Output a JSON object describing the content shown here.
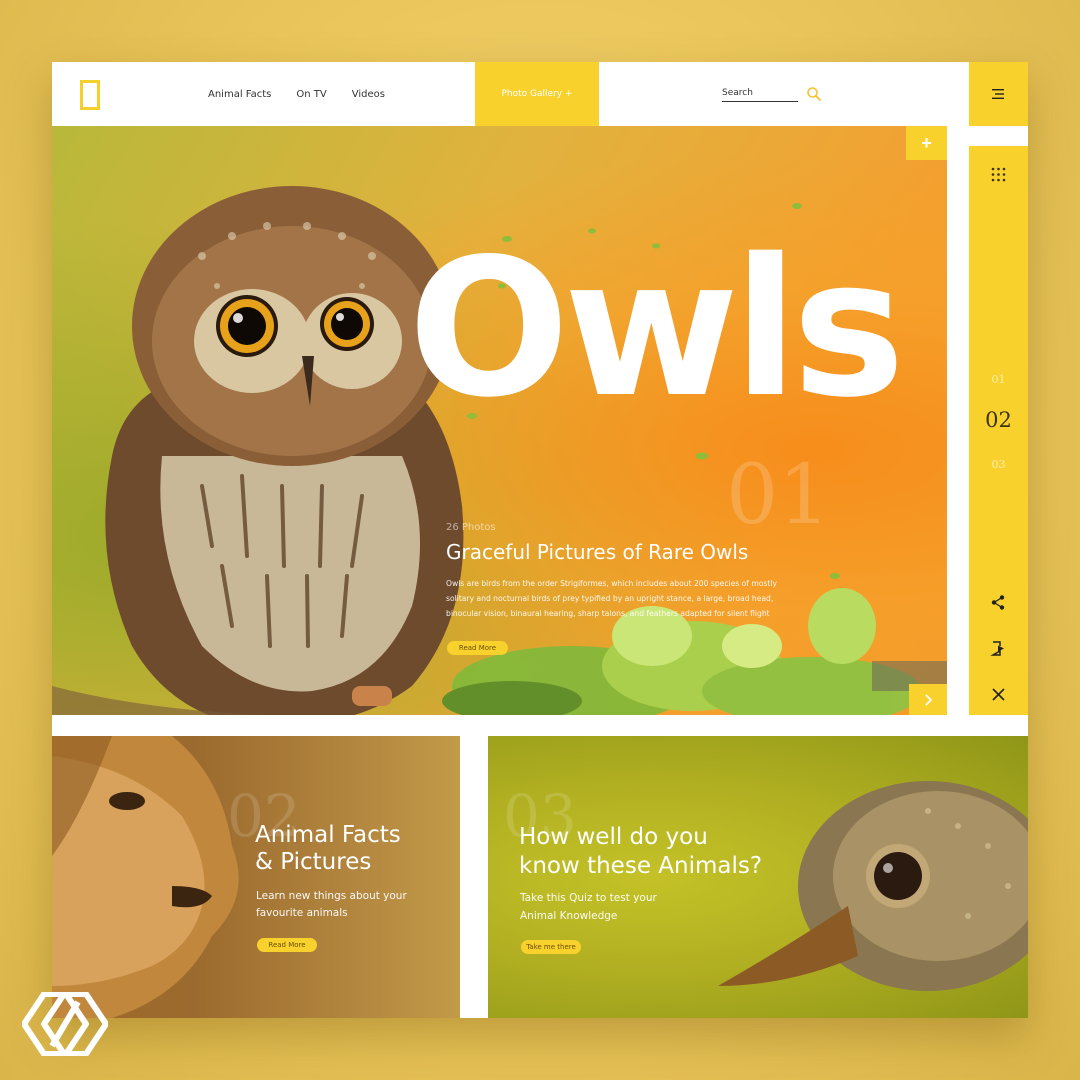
{
  "header": {
    "nav": [
      "Animal Facts",
      "On TV",
      "Videos"
    ],
    "gallery_tab": "Photo Gallery +",
    "search_label": "Search"
  },
  "hero": {
    "title": "Owls",
    "photo_count": "26 Photos",
    "bg_number": "01",
    "heading": "Graceful Pictures of Rare Owls",
    "description": "Owls are birds from the order Strigiformes, which includes about 200 species of mostly solitary and nocturnal birds of prey typified by an upright stance, a large, broad head, binocular vision, binaural hearing, sharp talons, and feathers adapted for silent flight",
    "button": "Read More",
    "plus": "+"
  },
  "rail": {
    "numbers": [
      "01",
      "02",
      "03"
    ]
  },
  "cards": [
    {
      "bg_number": "02",
      "title_line1": "Animal Facts",
      "title_line2": "& Pictures",
      "desc_line1": "Learn new things about your",
      "desc_line2": "favourite animals",
      "button": "Read More"
    },
    {
      "bg_number": "03",
      "title_line1": "How well do you",
      "title_line2": "know these Animals?",
      "desc_line1": "Take this Quiz to test your",
      "desc_line2": "Animal Knowledge",
      "button": "Take me there"
    }
  ],
  "colors": {
    "accent": "#f8d12c",
    "hero_orange": "#f49a2a",
    "lion_card": "#a06a28",
    "bird_card": "#b2b022"
  },
  "icons": [
    "logo-icon",
    "search-icon",
    "menu-icon",
    "plus-icon",
    "chevron-right-icon",
    "grid-dots-icon",
    "share-icon",
    "logout-icon",
    "close-icon"
  ]
}
